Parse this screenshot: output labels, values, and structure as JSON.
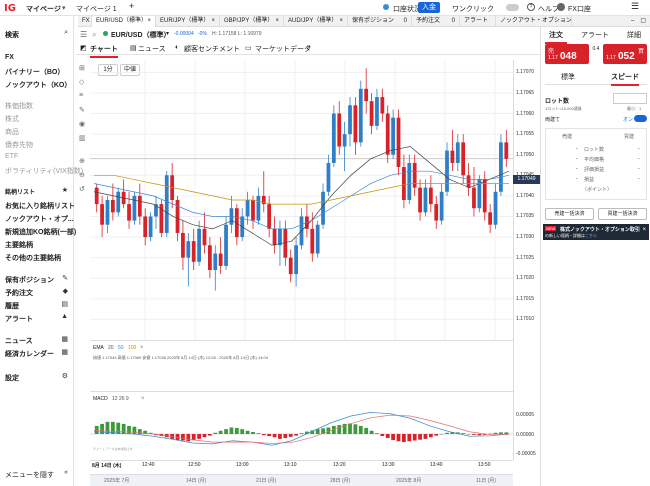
{
  "topbar": {
    "logo": "IG",
    "nav": [
      "マイページ",
      "マイページ 1"
    ],
    "account_status": "口座状況",
    "deposit_button": "入金",
    "one_click": "ワンクリック",
    "help": "ヘルプ",
    "account_type": "FX口座"
  },
  "product_tabs": [
    {
      "label": "FX",
      "count": ""
    },
    {
      "label": "EUR/USD（標準）",
      "count": ""
    },
    {
      "label": "EUR/JPY（標準）",
      "count": ""
    },
    {
      "label": "GBP/JPY（標準）",
      "count": ""
    },
    {
      "label": "AUD/JPY（標準）",
      "count": ""
    },
    {
      "label": "保有ポジション",
      "count": "0"
    },
    {
      "label": "予約注文",
      "count": "0"
    },
    {
      "label": "アラート",
      "count": ""
    },
    {
      "label": "ノックアウト・オプション",
      "count": ""
    }
  ],
  "sidebar": {
    "search": "検索",
    "markets": [
      "FX",
      "バイナリー（BO）",
      "ノックアウト（KO）"
    ],
    "grey_markets": [
      "株価指数",
      "株式",
      "商品",
      "債券先物",
      "ETF",
      "ボラティリティ(VIX指数)"
    ],
    "watchlist_title": "銘柄リスト",
    "watchlist": [
      "お気に入り銘柄リスト",
      "ノックアウト・オプ...",
      "新規追加KO銘柄(一部)",
      "主要銘柄",
      "その他の主要銘柄"
    ],
    "account_items": [
      "保有ポジション",
      "予約注文",
      "履歴",
      "アラート"
    ],
    "info_items": [
      "ニュース",
      "経済カレンダー"
    ],
    "settings": "設定",
    "hide_menu": "メニューを隠す"
  },
  "chart_header": {
    "instrument": "EUR/USD（標準）",
    "change": "-0.00004",
    "change_pct": "-0%",
    "hl": "H: 1.17158  L: 1.16979",
    "tabs": [
      "チャート",
      "ニュース",
      "顧客センチメント",
      "マーケットデータ"
    ],
    "timeframe": "1分",
    "chart_type": "中値"
  },
  "price_labels": [
    "1.17070",
    "1.17065",
    "1.17060",
    "1.17055",
    "1.17050",
    "1.17045",
    "1.17040",
    "1.17035",
    "1.17030",
    "1.17025",
    "1.17020",
    "1.17015",
    "1.17010"
  ],
  "current_price": "1.17049",
  "ema_info": {
    "label": "EMA",
    "p1": "20",
    "p2": "50",
    "p3": "100",
    "detail": "始値 1.17044  高値 1.17069  安値 1.17035  2025年 8月 14日 (木) 12:28 - 2025年 8月 14日 (木) 14:04"
  },
  "macd_info": {
    "label": "MACD",
    "params": "12  26  9"
  },
  "macd_labels": [
    "0.00005",
    "0.00000",
    "-0.00005"
  ],
  "macd_note": "チャート データは参考値です",
  "time_labels": [
    "8月 14日 (木)",
    "12:40",
    "12:50",
    "13:00",
    "13:10",
    "13:20",
    "13:30",
    "13:40",
    "13:50"
  ],
  "date_labels": [
    "2025年 7月",
    "14日 (月)",
    "21日 (月)",
    "28日 (月)",
    "2025年 8月",
    "11日 (月)"
  ],
  "chart_data": {
    "type": "candlestick",
    "colors": {
      "up": "#2f7fc8",
      "down": "#d7222a"
    },
    "ylim": [
      1.17005,
      1.17073
    ],
    "candles": [
      [
        1.17042,
        1.17043,
        1.17036,
        1.17038
      ],
      [
        1.17038,
        1.1704,
        1.1703,
        1.17033
      ],
      [
        1.17033,
        1.1704,
        1.17031,
        1.17039
      ],
      [
        1.17039,
        1.17043,
        1.17034,
        1.17036
      ],
      [
        1.17036,
        1.17042,
        1.17035,
        1.17041
      ],
      [
        1.17041,
        1.17044,
        1.17037,
        1.17038
      ],
      [
        1.17038,
        1.17041,
        1.17032,
        1.17034
      ],
      [
        1.17034,
        1.17041,
        1.17033,
        1.1704
      ],
      [
        1.1704,
        1.17043,
        1.17033,
        1.17035
      ],
      [
        1.17035,
        1.17037,
        1.17028,
        1.1703
      ],
      [
        1.1703,
        1.17036,
        1.17029,
        1.17035
      ],
      [
        1.17035,
        1.1704,
        1.17032,
        1.17038
      ],
      [
        1.17038,
        1.17039,
        1.1703,
        1.17031
      ],
      [
        1.17031,
        1.17046,
        1.1703,
        1.17045
      ],
      [
        1.17045,
        1.17048,
        1.17037,
        1.17039
      ],
      [
        1.17039,
        1.1704,
        1.17029,
        1.17031
      ],
      [
        1.17031,
        1.17034,
        1.17022,
        1.17025
      ],
      [
        1.17025,
        1.17031,
        1.17018,
        1.17029
      ],
      [
        1.17029,
        1.17032,
        1.17022,
        1.17024
      ],
      [
        1.17024,
        1.17034,
        1.17023,
        1.17032
      ],
      [
        1.17032,
        1.17036,
        1.17026,
        1.17028
      ],
      [
        1.17028,
        1.1703,
        1.1702,
        1.17022
      ],
      [
        1.17022,
        1.17028,
        1.17017,
        1.17026
      ],
      [
        1.17026,
        1.1703,
        1.17021,
        1.17023
      ],
      [
        1.17023,
        1.17035,
        1.17022,
        1.17033
      ],
      [
        1.17033,
        1.1704,
        1.17031,
        1.17037
      ],
      [
        1.17037,
        1.17038,
        1.17028,
        1.1703
      ],
      [
        1.1703,
        1.17037,
        1.17029,
        1.17035
      ],
      [
        1.17035,
        1.17041,
        1.17033,
        1.17039
      ],
      [
        1.17039,
        1.1704,
        1.17032,
        1.17034
      ],
      [
        1.17034,
        1.17042,
        1.17033,
        1.1704
      ],
      [
        1.1704,
        1.17046,
        1.17036,
        1.17038
      ],
      [
        1.17038,
        1.1704,
        1.1703,
        1.17032
      ],
      [
        1.17032,
        1.17035,
        1.17026,
        1.17028
      ],
      [
        1.17028,
        1.17034,
        1.17023,
        1.17032
      ],
      [
        1.17032,
        1.17034,
        1.17023,
        1.17025
      ],
      [
        1.17025,
        1.17027,
        1.17019,
        1.17021
      ],
      [
        1.17021,
        1.1703,
        1.17018,
        1.17028
      ],
      [
        1.17028,
        1.17037,
        1.17027,
        1.17035
      ],
      [
        1.17035,
        1.17038,
        1.1703,
        1.17032
      ],
      [
        1.17032,
        1.17036,
        1.17024,
        1.17026
      ],
      [
        1.17026,
        1.17034,
        1.17025,
        1.17033
      ],
      [
        1.17033,
        1.17043,
        1.17032,
        1.17041
      ],
      [
        1.17041,
        1.1705,
        1.1704,
        1.17048
      ],
      [
        1.17048,
        1.17062,
        1.17047,
        1.1706
      ],
      [
        1.1706,
        1.17063,
        1.1705,
        1.17052
      ],
      [
        1.17052,
        1.17058,
        1.17046,
        1.17055
      ],
      [
        1.17055,
        1.17064,
        1.17052,
        1.17062
      ],
      [
        1.17062,
        1.17064,
        1.1705,
        1.17053
      ],
      [
        1.17053,
        1.17068,
        1.17052,
        1.17066
      ],
      [
        1.17066,
        1.17071,
        1.1706,
        1.17063
      ],
      [
        1.17063,
        1.17065,
        1.17055,
        1.17057
      ],
      [
        1.17057,
        1.17066,
        1.17056,
        1.17064
      ],
      [
        1.17064,
        1.17066,
        1.17058,
        1.1706
      ],
      [
        1.1706,
        1.17062,
        1.17048,
        1.1705
      ],
      [
        1.1705,
        1.17061,
        1.17049,
        1.17059
      ],
      [
        1.17059,
        1.17061,
        1.17045,
        1.17047
      ],
      [
        1.17047,
        1.1705,
        1.17037,
        1.17039
      ],
      [
        1.17039,
        1.1705,
        1.17038,
        1.17048
      ],
      [
        1.17048,
        1.1705,
        1.1704,
        1.17042
      ],
      [
        1.17042,
        1.17044,
        1.17034,
        1.17036
      ],
      [
        1.17036,
        1.17044,
        1.17035,
        1.17042
      ],
      [
        1.17042,
        1.17045,
        1.17036,
        1.17038
      ],
      [
        1.17038,
        1.1704,
        1.17032,
        1.17034
      ],
      [
        1.17034,
        1.17043,
        1.17033,
        1.17041
      ],
      [
        1.17041,
        1.17053,
        1.1704,
        1.17051
      ],
      [
        1.17051,
        1.17056,
        1.17046,
        1.17048
      ],
      [
        1.17048,
        1.17055,
        1.17046,
        1.17053
      ],
      [
        1.17053,
        1.17055,
        1.17043,
        1.17045
      ],
      [
        1.17045,
        1.17048,
        1.1704,
        1.17042
      ],
      [
        1.17042,
        1.17047,
        1.17035,
        1.17037
      ],
      [
        1.17037,
        1.17045,
        1.17036,
        1.17044
      ],
      [
        1.17044,
        1.17046,
        1.17034,
        1.17036
      ],
      [
        1.17036,
        1.17038,
        1.17031,
        1.17033
      ],
      [
        1.17033,
        1.17043,
        1.17032,
        1.17041
      ],
      [
        1.17041,
        1.17055,
        1.1704,
        1.17053
      ],
      [
        1.17053,
        1.17056,
        1.17047,
        1.17049
      ]
    ],
    "ema20": [
      1.17041,
      1.1704,
      1.17039,
      1.17038,
      1.17035,
      1.17033,
      1.17032,
      1.17034,
      1.17031,
      1.17028,
      1.17029,
      1.17034,
      1.1704,
      1.17045,
      1.17049,
      1.17051,
      1.17052,
      1.17048,
      1.17044,
      1.17042,
      1.17044,
      1.17046
    ],
    "ema50": [
      1.17043,
      1.17042,
      1.17041,
      1.1704,
      1.17038,
      1.17036,
      1.17035,
      1.17035,
      1.17034,
      1.17032,
      1.17032,
      1.17034,
      1.17037,
      1.1704,
      1.17043,
      1.17045,
      1.17046,
      1.17046,
      1.17045,
      1.17044,
      1.17044,
      1.17045
    ],
    "ema100": [
      1.17045,
      1.17045,
      1.17044,
      1.17043,
      1.17042,
      1.17041,
      1.1704,
      1.17039,
      1.17039,
      1.17038,
      1.17038,
      1.17038,
      1.17039,
      1.1704,
      1.17041,
      1.17042,
      1.17043,
      1.17043,
      1.17043,
      1.17043,
      1.17043,
      1.17043
    ],
    "macd_line": [
      0.5,
      0.3,
      0.0,
      -0.5,
      -1.2,
      -2.0,
      -2.2,
      -1.5,
      -1.8,
      -2.5,
      -1.5,
      0.5,
      2.5,
      4.0,
      4.8,
      4.5,
      3.5,
      1.8,
      0.5,
      -0.5,
      -0.4,
      0.0
    ],
    "signal_line": [
      0.8,
      0.6,
      0.4,
      0.0,
      -0.6,
      -1.3,
      -1.8,
      -1.8,
      -1.8,
      -2.1,
      -1.9,
      -0.8,
      0.8,
      2.3,
      3.6,
      4.2,
      4.0,
      3.0,
      1.8,
      0.5,
      -0.1,
      -0.1
    ],
    "histogram": [
      2,
      2.5,
      3,
      3,
      2.8,
      2.5,
      2,
      1.8,
      1.2,
      0.8,
      0.3,
      -0.3,
      -0.5,
      -0.8,
      -1.2,
      -1.5,
      -1.6,
      -1.8,
      -1.5,
      -1.2,
      -0.8,
      -0.4,
      0.3,
      0.8,
      1.2,
      1.6,
      1.5,
      1.2,
      0.8,
      0.5,
      0.2,
      -0.3,
      -0.5,
      -0.8,
      -1.2,
      -1.0,
      -0.7,
      -0.4,
      0.2,
      0.6,
      0.9,
      1.2,
      1.4,
      1.6,
      2.0,
      2.2,
      2.5,
      2.6,
      2.4,
      2.0,
      1.5,
      0.8,
      0.2,
      -0.5,
      -1.0,
      -1.5,
      -1.8,
      -2.0,
      -1.8,
      -1.6,
      -1.4,
      -1.2,
      -0.8,
      -0.4,
      0.0,
      0.3,
      0.5,
      0.4,
      0.2,
      0.0,
      -0.2,
      -0.3,
      -0.2,
      0.1,
      0.3,
      0.4,
      0.4
    ]
  },
  "trade_panel": {
    "tabs": [
      "注文",
      "アラート",
      "詳細"
    ],
    "sell_label": "売",
    "sell_price_small": "1.17",
    "sell_price_big": "048",
    "buy_label": "買",
    "buy_price_small": "1.17",
    "buy_price_big": "052",
    "spread": "0.4",
    "mini_label": "最小：1",
    "order_types": [
      "標準",
      "スピード"
    ],
    "lot_label": "ロット数",
    "lot_note": "1ロット=10,000通貨",
    "both_side": "両建て",
    "toggle": "オン",
    "col_sell": "売建",
    "col_buy": "買建",
    "rows": [
      "ロット数",
      "平均価格",
      "評価損益",
      "損益",
      "（ポイント）"
    ],
    "row_vals": [
      "-",
      "-",
      "-",
      "-",
      "-"
    ],
    "close_sell": "売建一括決済",
    "close_buy": "買建一括決済",
    "banner_badge": "NEW",
    "banner_text": "株式ノックアウト・オプション取引",
    "banner_sub": "の新しい銘柄・詳細は",
    "banner_link": "こちら"
  }
}
